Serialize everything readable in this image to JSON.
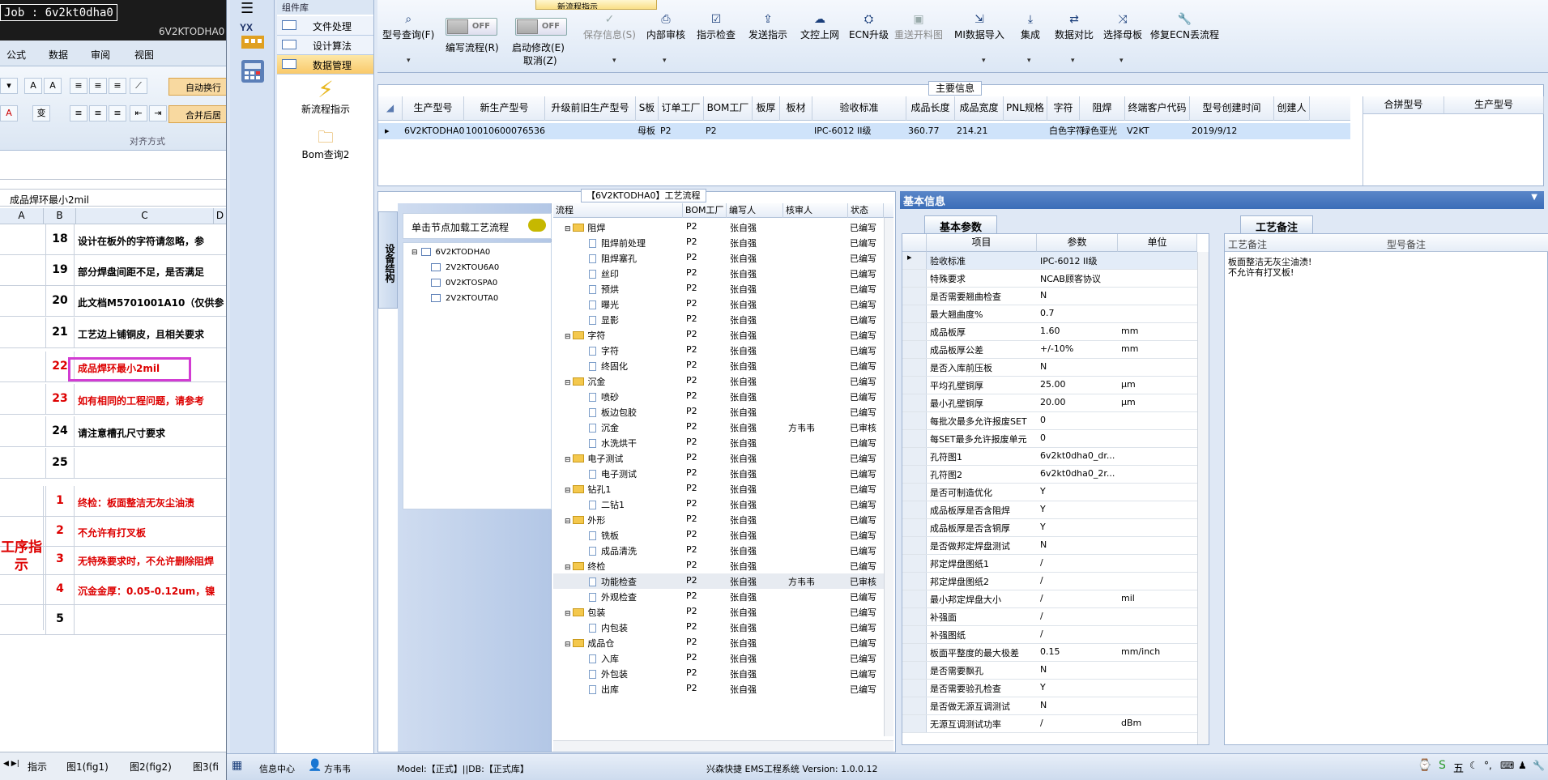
{
  "excel": {
    "job_label": "Job : 6v2kt0dha0",
    "job_sub": "6V2KTODHA0",
    "ribbon_tabs": [
      "公式",
      "数据",
      "审阅",
      "视图"
    ],
    "auto_wrap": "自动换行",
    "merge_center": "合并后居",
    "align_group": "对齐方式",
    "formula_text": "成品焊环最小2mil",
    "col_headers": [
      "A",
      "B",
      "C",
      "D"
    ],
    "rows": [
      {
        "num": "18",
        "text": "设计在板外的字符请忽略，参",
        "red": false
      },
      {
        "num": "19",
        "text": "部分焊盘间距不足，是否满足",
        "red": false
      },
      {
        "num": "20",
        "text": "此文档M5701001A10（仅供参",
        "red": false
      },
      {
        "num": "21",
        "text": "工艺边上铺铜皮，且相关要求",
        "red": false
      },
      {
        "num": "22",
        "text": "成品焊环最小2mil",
        "red": true
      },
      {
        "num": "23",
        "text": "如有相同的工程问题，请参考",
        "red": true
      },
      {
        "num": "24",
        "text": "请注意槽孔尺寸要求",
        "red": false
      },
      {
        "num": "25",
        "text": "",
        "red": false
      },
      {
        "num": "1",
        "text": "终检：板面整洁无灰尘油渍",
        "red": true
      },
      {
        "num": "2",
        "text": "不允许有打叉板",
        "red": true
      },
      {
        "num": "3",
        "text": "无特殊要求时，不允许删除阻焊",
        "red": true
      },
      {
        "num": "4",
        "text": "沉金金厚：0.05-0.12um，镍",
        "red": true
      },
      {
        "num": "5",
        "text": "",
        "red": false
      }
    ],
    "section_label": "工序指示",
    "sheet_tabs": [
      "指示",
      "图1(fig1)",
      "图2(fig2)",
      "图3(fi"
    ]
  },
  "sidebar": {
    "header": "组件库",
    "items": [
      {
        "label": "文件处理",
        "active": false
      },
      {
        "label": "设计算法",
        "active": false
      },
      {
        "label": "数据管理",
        "active": true
      }
    ],
    "big1": "新流程指示",
    "big2": "Bom查询2",
    "logo_text": "YX"
  },
  "toolbar": {
    "tab_label": "新流程指示",
    "items": [
      {
        "label": "型号查询(F)",
        "icon": "search-icon",
        "dim": false
      },
      {
        "label": "编写流程(R)",
        "icon": "toggle",
        "dim": false
      },
      {
        "label": "启动修改(E)",
        "icon": "toggle",
        "dim": false
      },
      {
        "label": "保存信息(S)",
        "icon": "check-icon",
        "dim": true
      },
      {
        "label": "内部审核",
        "icon": "print-icon",
        "dim": false
      },
      {
        "label": "指示检查",
        "icon": "check-box-icon",
        "dim": false
      },
      {
        "label": "发送指示",
        "icon": "upload-icon",
        "dim": false
      },
      {
        "label": "文控上网",
        "icon": "cloud-upload-icon",
        "dim": false
      },
      {
        "label": "ECN升级",
        "icon": "users-icon",
        "dim": false
      },
      {
        "label": "重送开料图",
        "icon": "image-icon",
        "dim": true
      },
      {
        "label": "MI数据导入",
        "icon": "import-icon",
        "dim": false
      },
      {
        "label": "集成",
        "icon": "download-icon",
        "dim": false
      },
      {
        "label": "数据对比",
        "icon": "compare-icon",
        "dim": false
      },
      {
        "label": "选择母板",
        "icon": "shuffle-icon",
        "dim": false
      },
      {
        "label": "修复ECN丢流程",
        "icon": "wrench-icon",
        "dim": false
      }
    ],
    "toggle_off": "OFF",
    "cancel_label": "取消(Z)"
  },
  "main_info": {
    "title": "主要信息",
    "headers": [
      "生产型号",
      "新生产型号",
      "升级前旧生产型号",
      "S板",
      "订单工厂",
      "BOM工厂",
      "板厚",
      "板材",
      "验收标准",
      "成品长度",
      "成品宽度",
      "PNL规格",
      "字符",
      "阻焊",
      "终端客户代码",
      "型号创建时间",
      "创建人"
    ],
    "row": [
      "6V2KTODHA0",
      "10010600076536",
      "",
      "母板",
      "P2",
      "P2",
      "",
      "",
      "IPC-6012 II级",
      "360.77",
      "214.21",
      "",
      "白色字符",
      "绿色亚光",
      "V2KT",
      "2019/9/12",
      ""
    ],
    "right_headers": [
      "合拼型号",
      "生产型号"
    ]
  },
  "process": {
    "title": "【6V2KTODHA0】工艺流程",
    "vert_tab": "设备结构",
    "tree_head": "单击节点加载工艺流程",
    "tree_nodes": [
      "6V2KTODHA0",
      "2V2KTOU6A0",
      "0V2KTOSPA0",
      "2V2KTOUTA0"
    ],
    "flow_headers": [
      "流程",
      "BOM工厂",
      "编写人",
      "核审人",
      "状态"
    ],
    "rows": [
      {
        "name": "阻焊",
        "group": true,
        "bom": "P2",
        "writer": "张自强",
        "reviewer": "",
        "status": "已编写"
      },
      {
        "name": "阻焊前处理",
        "group": false,
        "bom": "P2",
        "writer": "张自强",
        "reviewer": "",
        "status": "已编写"
      },
      {
        "name": "阻焊塞孔",
        "group": false,
        "bom": "P2",
        "writer": "张自强",
        "reviewer": "",
        "status": "已编写"
      },
      {
        "name": "丝印",
        "group": false,
        "bom": "P2",
        "writer": "张自强",
        "reviewer": "",
        "status": "已编写"
      },
      {
        "name": "预烘",
        "group": false,
        "bom": "P2",
        "writer": "张自强",
        "reviewer": "",
        "status": "已编写"
      },
      {
        "name": "曝光",
        "group": false,
        "bom": "P2",
        "writer": "张自强",
        "reviewer": "",
        "status": "已编写"
      },
      {
        "name": "显影",
        "group": false,
        "bom": "P2",
        "writer": "张自强",
        "reviewer": "",
        "status": "已编写"
      },
      {
        "name": "字符",
        "group": true,
        "bom": "P2",
        "writer": "张自强",
        "reviewer": "",
        "status": "已编写"
      },
      {
        "name": "字符",
        "group": false,
        "bom": "P2",
        "writer": "张自强",
        "reviewer": "",
        "status": "已编写"
      },
      {
        "name": "终固化",
        "group": false,
        "bom": "P2",
        "writer": "张自强",
        "reviewer": "",
        "status": "已编写"
      },
      {
        "name": "沉金",
        "group": true,
        "bom": "P2",
        "writer": "张自强",
        "reviewer": "",
        "status": "已编写"
      },
      {
        "name": "喷砂",
        "group": false,
        "bom": "P2",
        "writer": "张自强",
        "reviewer": "",
        "status": "已编写"
      },
      {
        "name": "板边包胶",
        "group": false,
        "bom": "P2",
        "writer": "张自强",
        "reviewer": "",
        "status": "已编写"
      },
      {
        "name": "沉金",
        "group": false,
        "bom": "P2",
        "writer": "张自强",
        "reviewer": "方韦韦",
        "status": "已审核"
      },
      {
        "name": "水洗烘干",
        "group": false,
        "bom": "P2",
        "writer": "张自强",
        "reviewer": "",
        "status": "已编写"
      },
      {
        "name": "电子测试",
        "group": true,
        "bom": "P2",
        "writer": "张自强",
        "reviewer": "",
        "status": "已编写"
      },
      {
        "name": "电子测试",
        "group": false,
        "bom": "P2",
        "writer": "张自强",
        "reviewer": "",
        "status": "已编写"
      },
      {
        "name": "钻孔1",
        "group": true,
        "bom": "P2",
        "writer": "张自强",
        "reviewer": "",
        "status": "已编写"
      },
      {
        "name": "二钻1",
        "group": false,
        "bom": "P2",
        "writer": "张自强",
        "reviewer": "",
        "status": "已编写"
      },
      {
        "name": "外形",
        "group": true,
        "bom": "P2",
        "writer": "张自强",
        "reviewer": "",
        "status": "已编写"
      },
      {
        "name": "铣板",
        "group": false,
        "bom": "P2",
        "writer": "张自强",
        "reviewer": "",
        "status": "已编写"
      },
      {
        "name": "成品清洗",
        "group": false,
        "bom": "P2",
        "writer": "张自强",
        "reviewer": "",
        "status": "已编写"
      },
      {
        "name": "终检",
        "group": true,
        "bom": "P2",
        "writer": "张自强",
        "reviewer": "",
        "status": "已编写"
      },
      {
        "name": "功能检查",
        "group": false,
        "bom": "P2",
        "writer": "张自强",
        "reviewer": "方韦韦",
        "status": "已审核",
        "sel": true
      },
      {
        "name": "外观检查",
        "group": false,
        "bom": "P2",
        "writer": "张自强",
        "reviewer": "",
        "status": "已编写"
      },
      {
        "name": "包装",
        "group": true,
        "bom": "P2",
        "writer": "张自强",
        "reviewer": "",
        "status": "已编写"
      },
      {
        "name": "内包装",
        "group": false,
        "bom": "P2",
        "writer": "张自强",
        "reviewer": "",
        "status": "已编写"
      },
      {
        "name": "成品仓",
        "group": true,
        "bom": "P2",
        "writer": "张自强",
        "reviewer": "",
        "status": "已编写"
      },
      {
        "name": "入库",
        "group": false,
        "bom": "P2",
        "writer": "张自强",
        "reviewer": "",
        "status": "已编写"
      },
      {
        "name": "外包装",
        "group": false,
        "bom": "P2",
        "writer": "张自强",
        "reviewer": "",
        "status": "已编写"
      },
      {
        "name": "出库",
        "group": false,
        "bom": "P2",
        "writer": "张自强",
        "reviewer": "",
        "status": "已编写"
      }
    ]
  },
  "basic": {
    "title": "基本信息",
    "tab_params": "基本参数",
    "tab_memo": "工艺备注",
    "param_headers": [
      "项目",
      "参数",
      "单位"
    ],
    "params": [
      {
        "item": "验收标准",
        "value": "IPC-6012 II级",
        "unit": ""
      },
      {
        "item": "特殊要求",
        "value": "NCAB顾客协议",
        "unit": ""
      },
      {
        "item": "是否需要翘曲检查",
        "value": "N",
        "unit": ""
      },
      {
        "item": "最大翘曲度%",
        "value": "0.7",
        "unit": ""
      },
      {
        "item": "成品板厚",
        "value": "1.60",
        "unit": "mm"
      },
      {
        "item": "成品板厚公差",
        "value": "+/-10%",
        "unit": "mm"
      },
      {
        "item": "是否入库前压板",
        "value": "N",
        "unit": ""
      },
      {
        "item": "平均孔壁铜厚",
        "value": "25.00",
        "unit": "μm"
      },
      {
        "item": "最小孔壁铜厚",
        "value": "20.00",
        "unit": "μm"
      },
      {
        "item": "每批次最多允许报废SET",
        "value": "0",
        "unit": ""
      },
      {
        "item": "每SET最多允许报废单元",
        "value": "0",
        "unit": ""
      },
      {
        "item": "孔符图1",
        "value": "6v2kt0dha0_dr...",
        "unit": ""
      },
      {
        "item": "孔符图2",
        "value": "6v2kt0dha0_2r...",
        "unit": ""
      },
      {
        "item": "是否可制造优化",
        "value": "Y",
        "unit": ""
      },
      {
        "item": "成品板厚是否含阻焊",
        "value": "Y",
        "unit": ""
      },
      {
        "item": "成品板厚是否含铜厚",
        "value": "Y",
        "unit": ""
      },
      {
        "item": "是否做邦定焊盘测试",
        "value": "N",
        "unit": ""
      },
      {
        "item": "邦定焊盘图纸1",
        "value": "/",
        "unit": ""
      },
      {
        "item": "邦定焊盘图纸2",
        "value": "/",
        "unit": ""
      },
      {
        "item": "最小邦定焊盘大小",
        "value": "/",
        "unit": "mil"
      },
      {
        "item": "补强面",
        "value": "/",
        "unit": ""
      },
      {
        "item": "补强图纸",
        "value": "/",
        "unit": ""
      },
      {
        "item": "板面平整度的最大极差",
        "value": "0.15",
        "unit": "mm/inch"
      },
      {
        "item": "是否需要飘孔",
        "value": "N",
        "unit": ""
      },
      {
        "item": "是否需要验孔检查",
        "value": "Y",
        "unit": ""
      },
      {
        "item": "是否做无源互调测试",
        "value": "N",
        "unit": ""
      },
      {
        "item": "无源互调测试功率",
        "value": "/",
        "unit": "dBm"
      }
    ],
    "memo_headers": [
      "工艺备注",
      "型号备注"
    ],
    "memo_text": "板面整洁无灰尘油渍!\n不允许有打叉板!"
  },
  "statusbar": {
    "info_center": "信息中心",
    "user": "方韦韦",
    "model": "Model:【正式】||DB:【正式库】",
    "system": "兴森快捷 EMS工程系统 Version: 1.0.0.12",
    "tray_text": "五"
  }
}
